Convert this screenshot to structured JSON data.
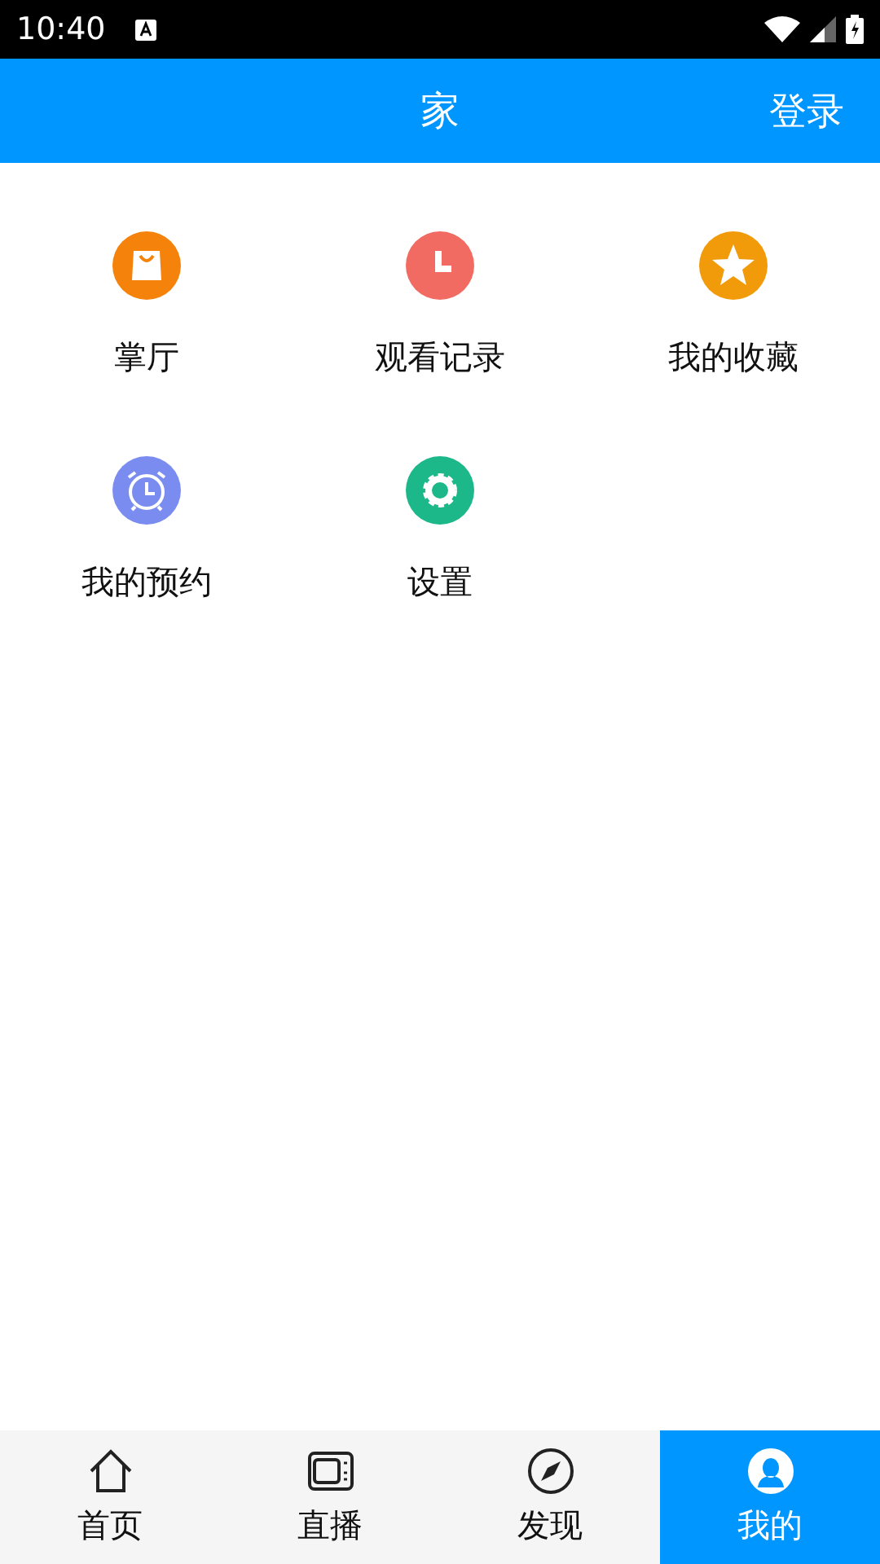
{
  "status_bar": {
    "time": "10:40"
  },
  "header": {
    "title": "家",
    "action": "登录"
  },
  "grid": [
    {
      "label": "掌厅",
      "kind": "bag",
      "color": "#f5820a"
    },
    {
      "label": "观看记录",
      "kind": "clock",
      "color": "#f26b62"
    },
    {
      "label": "我的收藏",
      "kind": "star",
      "color": "#f19a0a"
    },
    {
      "label": "我的预约",
      "kind": "alarm",
      "color": "#7b8cf0"
    },
    {
      "label": "设置",
      "kind": "gear",
      "color": "#1db88a"
    }
  ],
  "tabs": [
    {
      "label": "首页",
      "kind": "home",
      "selected": false
    },
    {
      "label": "直播",
      "kind": "tv",
      "selected": false
    },
    {
      "label": "发现",
      "kind": "compass",
      "selected": false
    },
    {
      "label": "我的",
      "kind": "user",
      "selected": true
    }
  ]
}
